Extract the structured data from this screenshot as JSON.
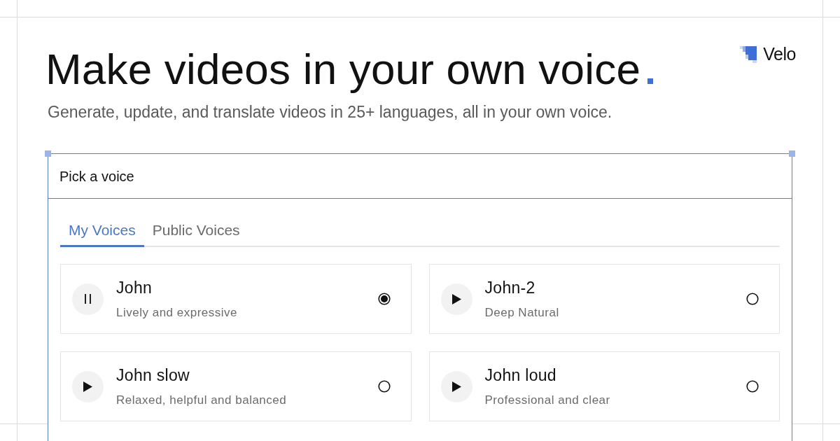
{
  "logo": {
    "text": "Velo"
  },
  "headline": "Make videos in your own voice",
  "subheadline": "Generate, update, and translate videos in 25+ languages, all in your own voice.",
  "panel": {
    "frame_selected": true,
    "title": "Pick a voice",
    "tabs": [
      {
        "label": "My Voices",
        "selected": true
      },
      {
        "label": "Public Voices",
        "selected": false
      }
    ],
    "voices": [
      {
        "name": "John",
        "description": "Lively and expressive",
        "playing": true,
        "selected": true
      },
      {
        "name": "John-2",
        "description": "Deep Natural",
        "playing": false,
        "selected": false
      },
      {
        "name": "John slow",
        "description": "Relaxed, helpful and balanced",
        "playing": false,
        "selected": false
      },
      {
        "name": "John loud",
        "description": "Professional and clear",
        "playing": false,
        "selected": false
      }
    ]
  }
}
